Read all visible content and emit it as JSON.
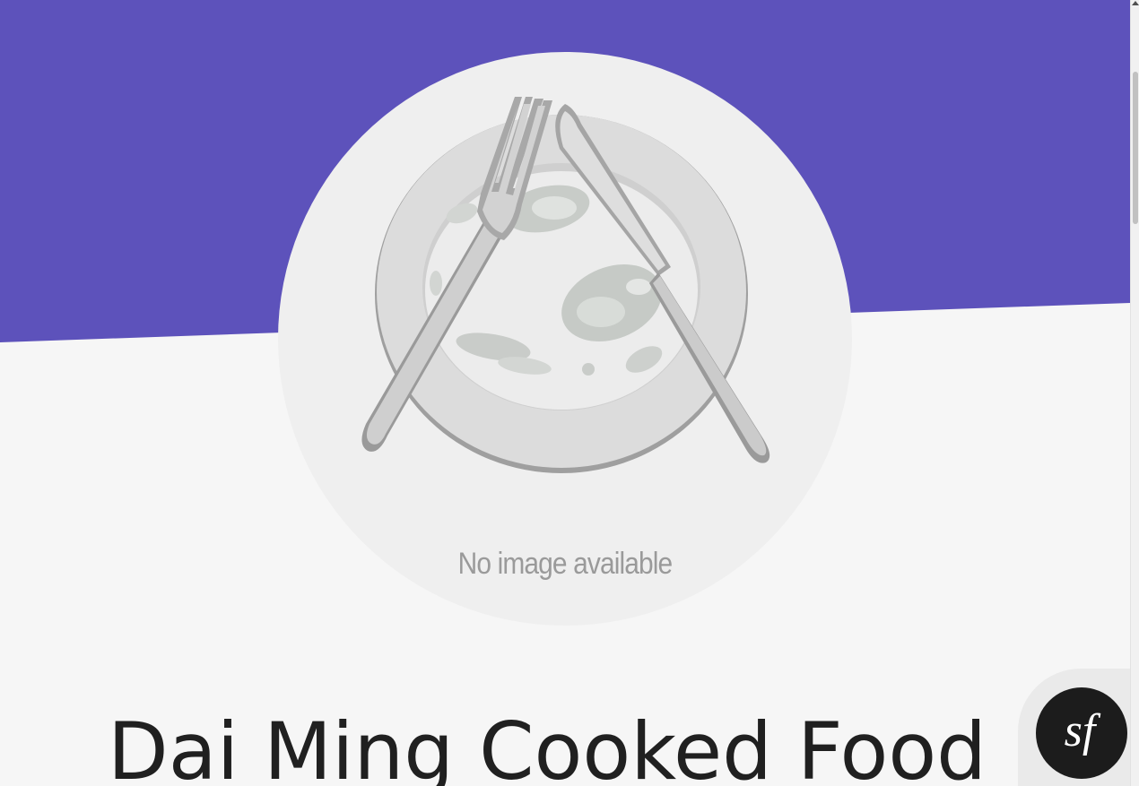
{
  "colors": {
    "hero_band": "#5d52bb",
    "page_background": "#f6f6f6",
    "image_circle": "#efefef",
    "caption_text": "#9a9a9a",
    "name_text": "#202020"
  },
  "restaurant": {
    "name": "Dai Ming Cooked Food",
    "image_placeholder": "No image available",
    "image_icon": "plate-fork-knife-icon"
  },
  "debug_toolbar": {
    "icon": "symfony-icon",
    "icon_text": "sf"
  }
}
